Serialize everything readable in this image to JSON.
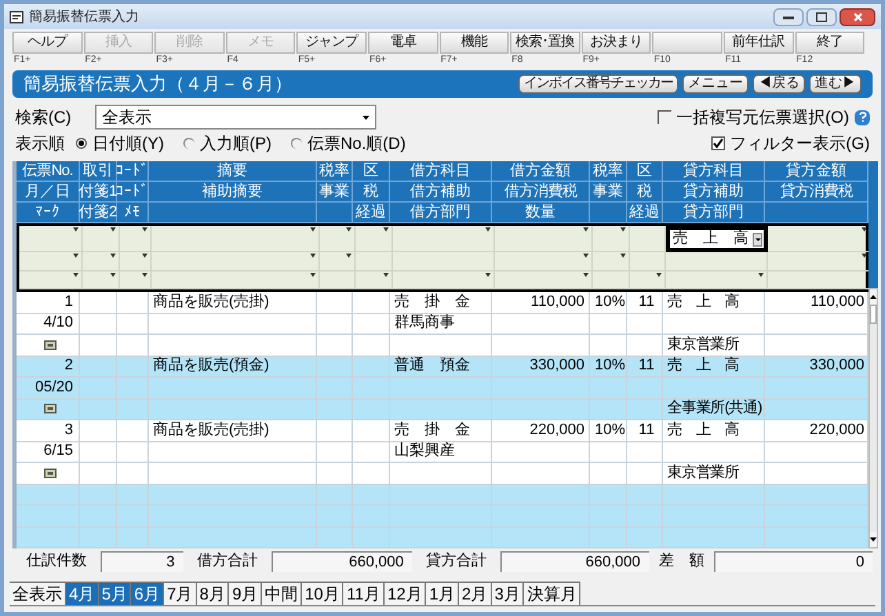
{
  "window": {
    "title": "簡易振替伝票入力"
  },
  "function_keys": [
    {
      "label": "ヘルプ",
      "key": "F1+",
      "disabled": false
    },
    {
      "label": "挿入",
      "key": "F2+",
      "disabled": true
    },
    {
      "label": "削除",
      "key": "F3+",
      "disabled": true
    },
    {
      "label": "メモ",
      "key": "F4",
      "disabled": true
    },
    {
      "label": "ジャンプ",
      "key": "F5+",
      "disabled": false
    },
    {
      "label": "電卓",
      "key": "F6+",
      "disabled": false
    },
    {
      "label": "機能",
      "key": "F7+",
      "disabled": false
    },
    {
      "label": "検索･置換",
      "key": "F8",
      "disabled": false
    },
    {
      "label": "お決まり",
      "key": "F9+",
      "disabled": false
    },
    {
      "key": "F10"
    },
    {
      "label": "前年仕訳",
      "key": "F11",
      "disabled": false
    },
    {
      "label": "終了",
      "key": "F12",
      "disabled": false
    }
  ],
  "banner": {
    "title": "簡易振替伝票入力（４月－６月）",
    "buttons": [
      {
        "label": "インボイス番号チェッカー"
      },
      {
        "label": "メニュー"
      },
      {
        "label": "◀戻る"
      },
      {
        "label": "進む▶"
      }
    ]
  },
  "search": {
    "label": "検索(C)",
    "value": "全表示"
  },
  "bulk_copy": {
    "label": "一括複写元伝票選択(O)",
    "checked": false
  },
  "sort": {
    "label": "表示順",
    "options": [
      {
        "label": "日付順(Y)",
        "selected": true
      },
      {
        "label": "入力順(P)",
        "selected": false
      },
      {
        "label": "伝票No.順(D)",
        "selected": false
      }
    ]
  },
  "filter_display": {
    "label": "フィルター表示(G)",
    "checked": true
  },
  "grid": {
    "columns": [
      {
        "line1": "伝票No.",
        "line2": "月／日",
        "line3": "ﾏｰｸ"
      },
      {
        "line1": "取引",
        "line2": "付箋1",
        "line3": "付箋2"
      },
      {
        "line1": "ｺｰﾄﾞ",
        "line2": "ｺｰﾄﾞ",
        "line3": "ﾒﾓ"
      },
      {
        "line1": "摘要",
        "line2": "補助摘要"
      },
      {
        "line1": "税率",
        "line2": "事業"
      },
      {
        "line1": "区",
        "line2": "税",
        "line3": "経過"
      },
      {
        "line1": "借方科目",
        "line2": "借方補助",
        "line3": "借方部門"
      },
      {
        "line1": "借方金額",
        "line2": "借方消費税",
        "line3": "数量"
      },
      {
        "line1": "税率",
        "line2": "事業"
      },
      {
        "line1": "区",
        "line2": "税",
        "line3": "経過"
      },
      {
        "line1": "貸方科目",
        "line2": "貸方補助",
        "line3": "貸方部門"
      },
      {
        "line1": "貸方金額",
        "line2": "貸方消費税"
      }
    ],
    "filter_rows": [
      {
        "cells": [
          {
            "dropdown": true
          },
          {
            "dropdown": true
          },
          {
            "dropdown": true
          },
          {
            "dropdown": true
          },
          {
            "dropdown": true
          },
          {
            "dropdown": true
          },
          {
            "dropdown": true
          },
          {
            "dropdown": true
          },
          {
            "dropdown": true
          },
          {
            "dropdown": false
          },
          {
            "value": "売　上　高"
          },
          {
            "dropdown": true
          }
        ]
      },
      {
        "cells": [
          {
            "dropdown": true
          },
          {
            "dropdown": true
          },
          {
            "dropdown": true
          },
          {
            "dropdown": true
          },
          {
            "dropdown": true
          },
          {
            "dropdown": false
          },
          {
            "dropdown": false
          },
          {
            "dropdown": true
          },
          {
            "dropdown": true
          },
          {
            "dropdown": false
          },
          {
            "dropdown": false
          },
          {
            "dropdown": true
          }
        ]
      },
      {
        "cells": [
          {
            "dropdown": true
          },
          {
            "dropdown": true
          },
          {
            "dropdown": true
          },
          {
            "dropdown": true
          },
          {
            "dropdown": false
          },
          {
            "dropdown": true
          },
          {
            "dropdown": true
          },
          {
            "dropdown": true
          },
          {
            "dropdown": false
          },
          {
            "dropdown": true
          },
          {
            "dropdown": true
          },
          {
            "dropdown": false
          }
        ]
      }
    ],
    "entries": [
      {
        "no": "1",
        "date": "4/10",
        "mark": true,
        "summary": "商品を販売(売掛)",
        "debit_account": "売　掛　金",
        "debit_sub": "群馬商事",
        "debit_amount": "110,000",
        "debit_tax_rate": "10%",
        "debit_tax_code": "11",
        "credit_account": "売　上　高",
        "credit_dept": "東京営業所",
        "credit_amount": "110,000"
      },
      {
        "no": "2",
        "date": "05/20",
        "mark": true,
        "summary": "商品を販売(預金)",
        "debit_account": "普通　預金",
        "debit_amount": "330,000",
        "debit_tax_rate": "10%",
        "debit_tax_code": "11",
        "credit_account": "売　上　高",
        "credit_dept": "全事業所(共通)",
        "credit_amount": "330,000"
      },
      {
        "no": "3",
        "date": "6/15",
        "mark": true,
        "summary": "商品を販売(売掛)",
        "debit_account": "売　掛　金",
        "debit_sub": "山梨興産",
        "debit_amount": "220,000",
        "debit_tax_rate": "10%",
        "debit_tax_code": "11",
        "credit_account": "売　上　高",
        "credit_dept": "東京営業所",
        "credit_amount": "220,000"
      }
    ]
  },
  "totals": [
    {
      "label": "仕訳件数",
      "value": "3"
    },
    {
      "label": "借方合計",
      "value": "660,000"
    },
    {
      "label": "貸方合計",
      "value": "660,000"
    },
    {
      "label": "差　額",
      "value": "0"
    }
  ],
  "month_tabs": [
    {
      "label": "全表示",
      "selected": false
    },
    {
      "label": "4月",
      "selected": true
    },
    {
      "label": "5月",
      "selected": true
    },
    {
      "label": "6月",
      "selected": true
    },
    {
      "label": "7月",
      "selected": false
    },
    {
      "label": "8月",
      "selected": false
    },
    {
      "label": "9月",
      "selected": false
    },
    {
      "label": "中間",
      "selected": false
    },
    {
      "label": "10月",
      "selected": false
    },
    {
      "label": "11月",
      "selected": false
    },
    {
      "label": "12月",
      "selected": false
    },
    {
      "label": "1月",
      "selected": false
    },
    {
      "label": "2月",
      "selected": false
    },
    {
      "label": "3月",
      "selected": false
    },
    {
      "label": "決算月",
      "selected": false
    }
  ]
}
